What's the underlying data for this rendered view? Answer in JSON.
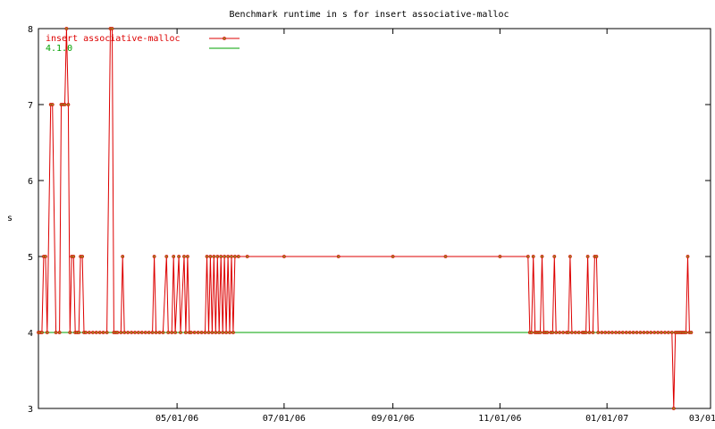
{
  "chart_data": {
    "type": "line",
    "title": "Benchmark runtime in s for insert associative-malloc",
    "ylabel": "s",
    "xlabel": "",
    "xlim": [
      "2006-02-11",
      "2007-03-01"
    ],
    "ylim": [
      3,
      8
    ],
    "yticks": [
      "3",
      "4",
      "5",
      "6",
      "7",
      "8"
    ],
    "xticks": [
      {
        "label": "05/01/06",
        "date": "2006-05-01"
      },
      {
        "label": "07/01/06",
        "date": "2006-07-01"
      },
      {
        "label": "09/01/06",
        "date": "2006-09-01"
      },
      {
        "label": "11/01/06",
        "date": "2006-11-01"
      },
      {
        "label": "01/01/07",
        "date": "2007-01-01"
      },
      {
        "label": "03/01/07",
        "date": "2007-03-01"
      }
    ],
    "grid": false,
    "legend_position": "top-left",
    "colors": {
      "series": "#dd0000",
      "marker": "#a08020",
      "reference": "#00a000",
      "axis": "#000000"
    },
    "series": [
      {
        "name": "insert associative-malloc",
        "style": "linespoints",
        "color": "#dd0000",
        "points": [
          [
            "2006-02-11",
            4
          ],
          [
            "2006-02-12",
            4
          ],
          [
            "2006-02-13",
            4
          ],
          [
            "2006-02-14",
            5
          ],
          [
            "2006-02-15",
            5
          ],
          [
            "2006-02-16",
            4
          ],
          [
            "2006-02-18",
            7
          ],
          [
            "2006-02-19",
            7
          ],
          [
            "2006-02-21",
            4
          ],
          [
            "2006-02-23",
            4
          ],
          [
            "2006-02-24",
            7
          ],
          [
            "2006-02-25",
            7
          ],
          [
            "2006-02-26",
            7
          ],
          [
            "2006-02-27",
            8
          ],
          [
            "2006-02-28",
            7
          ],
          [
            "2006-03-01",
            4
          ],
          [
            "2006-03-02",
            5
          ],
          [
            "2006-03-03",
            5
          ],
          [
            "2006-03-04",
            4
          ],
          [
            "2006-03-05",
            4
          ],
          [
            "2006-03-06",
            4
          ],
          [
            "2006-03-07",
            5
          ],
          [
            "2006-03-08",
            5
          ],
          [
            "2006-03-09",
            4
          ],
          [
            "2006-03-10",
            4
          ],
          [
            "2006-03-12",
            4
          ],
          [
            "2006-03-14",
            4
          ],
          [
            "2006-03-16",
            4
          ],
          [
            "2006-03-18",
            4
          ],
          [
            "2006-03-20",
            4
          ],
          [
            "2006-03-22",
            4
          ],
          [
            "2006-03-24",
            8
          ],
          [
            "2006-03-25",
            8
          ],
          [
            "2006-03-26",
            4
          ],
          [
            "2006-03-27",
            4
          ],
          [
            "2006-03-28",
            4
          ],
          [
            "2006-03-30",
            4
          ],
          [
            "2006-03-31",
            5
          ],
          [
            "2006-04-01",
            4
          ],
          [
            "2006-04-03",
            4
          ],
          [
            "2006-04-05",
            4
          ],
          [
            "2006-04-07",
            4
          ],
          [
            "2006-04-09",
            4
          ],
          [
            "2006-04-11",
            4
          ],
          [
            "2006-04-13",
            4
          ],
          [
            "2006-04-15",
            4
          ],
          [
            "2006-04-17",
            4
          ],
          [
            "2006-04-18",
            5
          ],
          [
            "2006-04-19",
            4
          ],
          [
            "2006-04-21",
            4
          ],
          [
            "2006-04-23",
            4
          ],
          [
            "2006-04-25",
            5
          ],
          [
            "2006-04-26",
            4
          ],
          [
            "2006-04-28",
            4
          ],
          [
            "2006-04-29",
            5
          ],
          [
            "2006-04-30",
            4
          ],
          [
            "2006-05-02",
            5
          ],
          [
            "2006-05-03",
            4
          ],
          [
            "2006-05-05",
            5
          ],
          [
            "2006-05-06",
            4
          ],
          [
            "2006-05-07",
            5
          ],
          [
            "2006-05-08",
            4
          ],
          [
            "2006-05-09",
            4
          ],
          [
            "2006-05-11",
            4
          ],
          [
            "2006-05-13",
            4
          ],
          [
            "2006-05-15",
            4
          ],
          [
            "2006-05-17",
            4
          ],
          [
            "2006-05-18",
            5
          ],
          [
            "2006-05-19",
            4
          ],
          [
            "2006-05-20",
            5
          ],
          [
            "2006-05-21",
            4
          ],
          [
            "2006-05-22",
            5
          ],
          [
            "2006-05-23",
            4
          ],
          [
            "2006-05-24",
            5
          ],
          [
            "2006-05-25",
            4
          ],
          [
            "2006-05-26",
            5
          ],
          [
            "2006-05-27",
            4
          ],
          [
            "2006-05-28",
            5
          ],
          [
            "2006-05-29",
            4
          ],
          [
            "2006-05-30",
            5
          ],
          [
            "2006-05-31",
            4
          ],
          [
            "2006-06-01",
            5
          ],
          [
            "2006-06-02",
            4
          ],
          [
            "2006-06-03",
            5
          ],
          [
            "2006-06-05",
            5
          ],
          [
            "2006-06-10",
            5
          ],
          [
            "2006-07-01",
            5
          ],
          [
            "2006-08-01",
            5
          ],
          [
            "2006-09-01",
            5
          ],
          [
            "2006-10-01",
            5
          ],
          [
            "2006-11-01",
            5
          ],
          [
            "2006-11-17",
            5
          ],
          [
            "2006-11-18",
            4
          ],
          [
            "2006-11-19",
            4
          ],
          [
            "2006-11-20",
            5
          ],
          [
            "2006-11-21",
            4
          ],
          [
            "2006-11-22",
            4
          ],
          [
            "2006-11-23",
            4
          ],
          [
            "2006-11-24",
            4
          ],
          [
            "2006-11-25",
            5
          ],
          [
            "2006-11-26",
            4
          ],
          [
            "2006-11-27",
            4
          ],
          [
            "2006-11-28",
            4
          ],
          [
            "2006-11-30",
            4
          ],
          [
            "2006-12-01",
            4
          ],
          [
            "2006-12-02",
            5
          ],
          [
            "2006-12-03",
            4
          ],
          [
            "2006-12-05",
            4
          ],
          [
            "2006-12-07",
            4
          ],
          [
            "2006-12-09",
            4
          ],
          [
            "2006-12-10",
            4
          ],
          [
            "2006-12-11",
            5
          ],
          [
            "2006-12-12",
            4
          ],
          [
            "2006-12-14",
            4
          ],
          [
            "2006-12-16",
            4
          ],
          [
            "2006-12-18",
            4
          ],
          [
            "2006-12-19",
            4
          ],
          [
            "2006-12-20",
            4
          ],
          [
            "2006-12-21",
            5
          ],
          [
            "2006-12-22",
            4
          ],
          [
            "2006-12-24",
            4
          ],
          [
            "2006-12-25",
            5
          ],
          [
            "2006-12-26",
            5
          ],
          [
            "2006-12-27",
            4
          ],
          [
            "2006-12-29",
            4
          ],
          [
            "2006-12-31",
            4
          ],
          [
            "2007-01-02",
            4
          ],
          [
            "2007-01-04",
            4
          ],
          [
            "2007-01-06",
            4
          ],
          [
            "2007-01-08",
            4
          ],
          [
            "2007-01-10",
            4
          ],
          [
            "2007-01-12",
            4
          ],
          [
            "2007-01-14",
            4
          ],
          [
            "2007-01-16",
            4
          ],
          [
            "2007-01-18",
            4
          ],
          [
            "2007-01-20",
            4
          ],
          [
            "2007-01-22",
            4
          ],
          [
            "2007-01-24",
            4
          ],
          [
            "2007-01-26",
            4
          ],
          [
            "2007-01-28",
            4
          ],
          [
            "2007-01-30",
            4
          ],
          [
            "2007-02-01",
            4
          ],
          [
            "2007-02-03",
            4
          ],
          [
            "2007-02-05",
            4
          ],
          [
            "2007-02-07",
            4
          ],
          [
            "2007-02-08",
            3
          ],
          [
            "2007-02-09",
            4
          ],
          [
            "2007-02-10",
            4
          ],
          [
            "2007-02-11",
            4
          ],
          [
            "2007-02-12",
            4
          ],
          [
            "2007-02-13",
            4
          ],
          [
            "2007-02-14",
            4
          ],
          [
            "2007-02-15",
            4
          ],
          [
            "2007-02-16",
            5
          ],
          [
            "2007-02-17",
            4
          ],
          [
            "2007-02-18",
            4
          ]
        ]
      },
      {
        "name": "4.1.0",
        "style": "line",
        "color": "#00a000",
        "points": [
          [
            "2006-02-11",
            4
          ],
          [
            "2007-02-18",
            4
          ]
        ]
      }
    ]
  }
}
